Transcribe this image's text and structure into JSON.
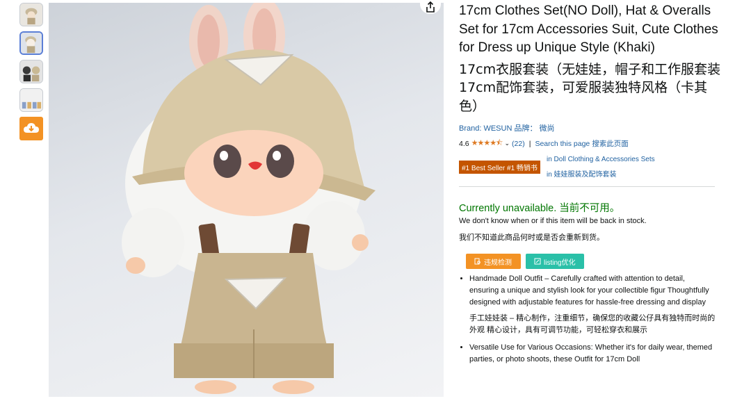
{
  "product": {
    "title": "17cm Clothes Set(NO Doll), Hat & Overalls Set for 17cm Accessories Suit, Cute Clothes for Dress up Unique Style (Khaki)",
    "title_cn": "17cm衣服套装（无娃娃，帽子和工作服套装17cm配饰套装，可爱服装独特风格（卡其色）",
    "brand_label": "Brand: WESUN 品牌： 微尚",
    "rating": "4.6",
    "stars": "★★★★⯪",
    "review_count": "(22)",
    "search_label": "Search this page",
    "search_label_cn": "搜索此页面",
    "best_seller_badge": "#1 Best Seller  #1 畅销书",
    "category_link": "in Doll Clothing & Accessories Sets",
    "category_link_cn": "in 娃娃服装及配饰套装",
    "availability": "Currently unavailable.  当前不可用。",
    "availability_note": "We don't know when or if this item will be back in stock.",
    "availability_note_cn": "我们不知道此商品何时或是否会重新到货。"
  },
  "tools": {
    "violation_check": "违规检测",
    "listing_optimize": "listing优化"
  },
  "bullets": [
    {
      "text": "Handmade Doll Outfit – Carefully crafted with attention to detail, ensuring a unique and stylish look for your collectible figur Thoughtfully designed with adjustable features for hassle-free dressing and display",
      "text_cn": "手工娃娃装 – 精心制作，注重细节，确保您的收藏公仔具有独特而时尚的外观 精心设计，具有可调节功能，可轻松穿衣和展示"
    },
    {
      "text": "Versatile Use for Various Occasions: Whether it's for daily wear, themed parties, or photo shoots, these Outfit for 17cm Doll"
    }
  ],
  "icons": {
    "share": "share-icon",
    "download": "cloud-download-icon",
    "chevron": "chevron-down-icon"
  },
  "colors": {
    "link": "#2162a1",
    "available_green": "#007600",
    "best_seller": "#c45500",
    "star": "#de7921",
    "tool_orange": "#f39224",
    "tool_teal": "#2ac0a8"
  }
}
